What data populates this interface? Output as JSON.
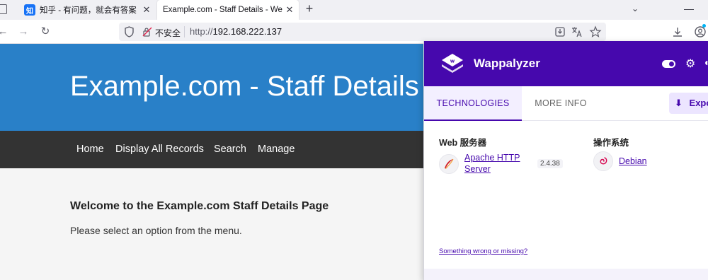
{
  "browser": {
    "tabs": [
      {
        "title": "知乎 - 有问题，就会有答案",
        "favicon_text": "知",
        "active": false
      },
      {
        "title": "Example.com - Staff Details - We",
        "active": true
      }
    ],
    "new_tab_label": "+",
    "close_glyph": "✕",
    "tab_list_glyph": "⌄",
    "minimize_glyph": "—",
    "nav": {
      "back": "←",
      "forward": "→",
      "reload": "↻"
    },
    "address": {
      "insecure_label": "不安全",
      "url_scheme": "http://",
      "url_host": "192.168.222.137"
    },
    "accent_color": "#00b3f4"
  },
  "page": {
    "banner_title": "Example.com - Staff Details",
    "banner_color": "#2980c8",
    "menu": [
      "Home",
      "Display All Records",
      "Search",
      "Manage"
    ],
    "welcome_heading": "Welcome to the Example.com Staff Details Page",
    "instruction": "Please select an option from the menu."
  },
  "wappalyzer": {
    "name": "Wappalyzer",
    "brand_color": "#4608ad",
    "tabs": {
      "technologies": "TECHNOLOGIES",
      "more_info": "MORE INFO"
    },
    "export_label": "Expo",
    "categories": [
      {
        "name": "Web 服务器",
        "items": [
          {
            "name_line1": "Apache HTTP",
            "name_line2": "Server",
            "version": "2.4.38",
            "icon": "apache-feather-icon"
          }
        ]
      },
      {
        "name": "操作系统",
        "items": [
          {
            "name_line1": "Debian",
            "version": "",
            "icon": "debian-swirl-icon"
          }
        ]
      }
    ],
    "report_link": "Something wrong or missing?"
  }
}
